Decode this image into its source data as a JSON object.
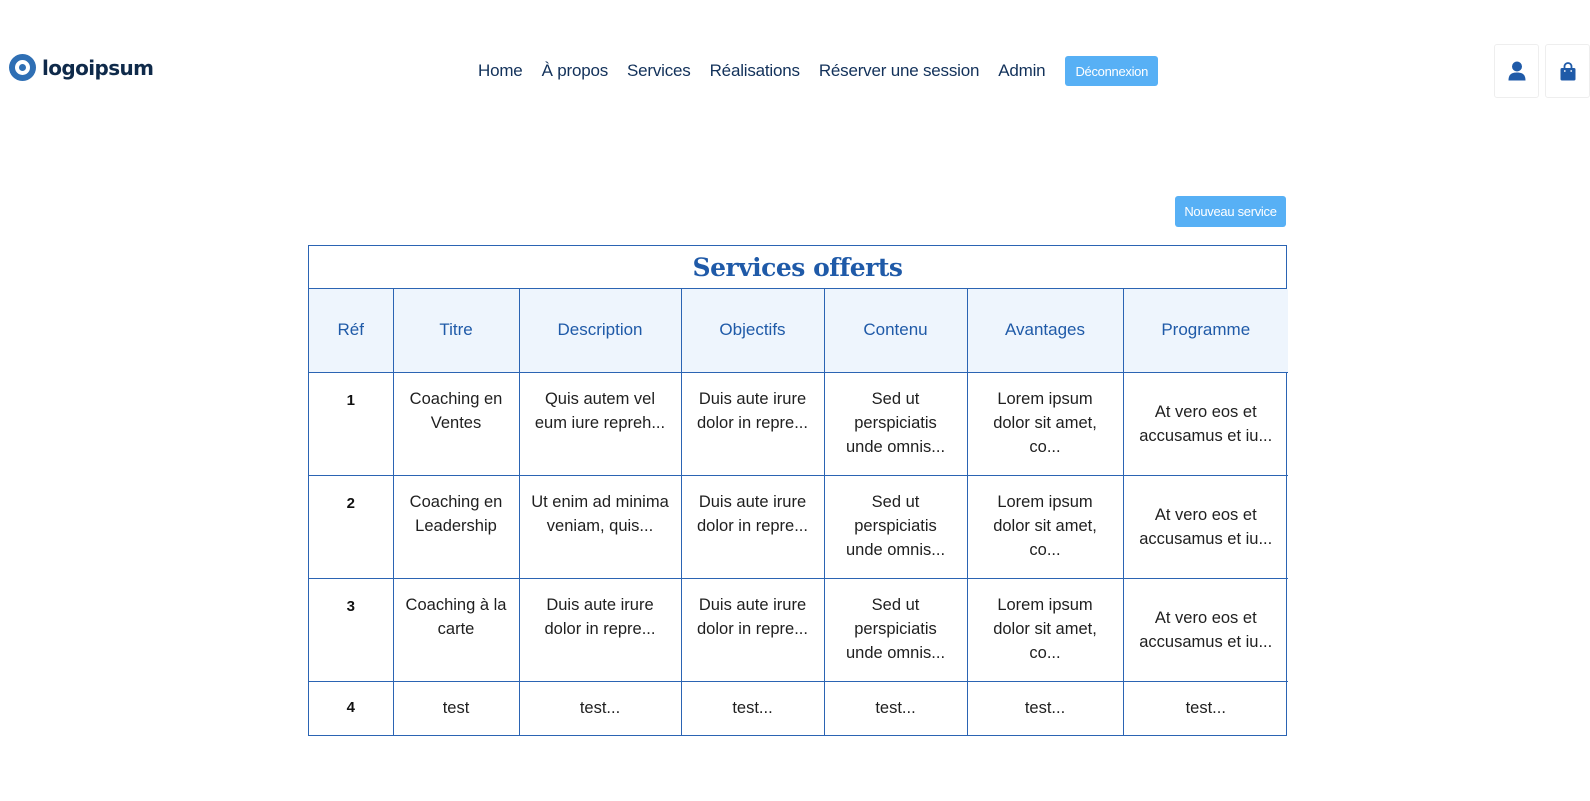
{
  "header": {
    "logo_text": "logoipsum",
    "nav": [
      "Home",
      "À propos",
      "Services",
      "Réalisations",
      "Réserver une session",
      "Admin"
    ],
    "logout_label": "Déconnexion",
    "icons": [
      "user-icon",
      "shopping-bag-icon"
    ]
  },
  "main": {
    "new_service_label": "Nouveau service",
    "table": {
      "title": "Services offerts",
      "columns": [
        "Réf",
        "Titre",
        "Description",
        "Objectifs",
        "Contenu",
        "Avantages",
        "Programme"
      ],
      "rows": [
        [
          "1",
          "Coaching en Ventes",
          "Quis autem vel eum iure repreh...",
          "Duis aute irure dolor in repre...",
          "Sed ut perspiciatis unde omnis...",
          "Lorem ipsum dolor sit amet, co...",
          "At vero eos et accusamus et iu..."
        ],
        [
          "2",
          "Coaching en Leadership",
          "Ut enim ad minima veniam, quis...",
          "Duis aute irure dolor in repre...",
          "Sed ut perspiciatis unde omnis...",
          "Lorem ipsum dolor sit amet, co...",
          "At vero eos et accusamus et iu..."
        ],
        [
          "3",
          "Coaching à la carte",
          "Duis aute irure dolor in repre...",
          "Duis aute irure dolor in repre...",
          "Sed ut perspiciatis unde omnis...",
          "Lorem ipsum dolor sit amet, co...",
          "At vero eos et accusamus et iu..."
        ],
        [
          "4",
          "test",
          "test...",
          "test...",
          "test...",
          "test...",
          "test..."
        ]
      ]
    }
  },
  "colors": {
    "accent": "#57b0f5",
    "brand_blue": "#1f5aa8",
    "table_border": "#2b64b3",
    "header_bg": "#eef5fd",
    "nav_text": "#12315a"
  }
}
